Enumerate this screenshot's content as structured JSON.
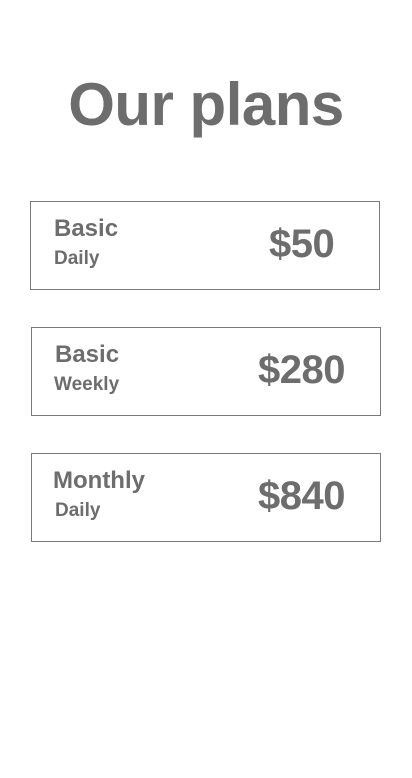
{
  "page": {
    "title": "Our plans"
  },
  "plans": [
    {
      "name": "Basic",
      "period": "Daily",
      "price": "$50"
    },
    {
      "name": "Basic",
      "period": "Weekly",
      "price": "$280"
    },
    {
      "name": "Monthly",
      "period": "Daily",
      "price": "$840"
    }
  ],
  "colors": {
    "text": "#6d6d6d",
    "border": "#7a7a7a",
    "background": "#ffffff"
  }
}
